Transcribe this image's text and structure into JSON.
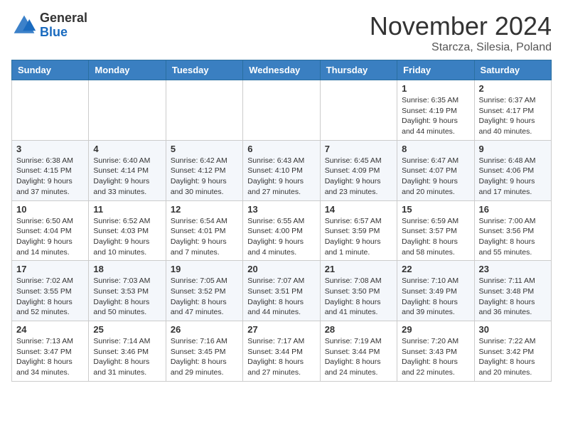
{
  "header": {
    "logo_general": "General",
    "logo_blue": "Blue",
    "month_title": "November 2024",
    "location": "Starcza, Silesia, Poland"
  },
  "days_of_week": [
    "Sunday",
    "Monday",
    "Tuesday",
    "Wednesday",
    "Thursday",
    "Friday",
    "Saturday"
  ],
  "weeks": [
    [
      {
        "day": "",
        "detail": ""
      },
      {
        "day": "",
        "detail": ""
      },
      {
        "day": "",
        "detail": ""
      },
      {
        "day": "",
        "detail": ""
      },
      {
        "day": "",
        "detail": ""
      },
      {
        "day": "1",
        "detail": "Sunrise: 6:35 AM\nSunset: 4:19 PM\nDaylight: 9 hours and 44 minutes."
      },
      {
        "day": "2",
        "detail": "Sunrise: 6:37 AM\nSunset: 4:17 PM\nDaylight: 9 hours and 40 minutes."
      }
    ],
    [
      {
        "day": "3",
        "detail": "Sunrise: 6:38 AM\nSunset: 4:15 PM\nDaylight: 9 hours and 37 minutes."
      },
      {
        "day": "4",
        "detail": "Sunrise: 6:40 AM\nSunset: 4:14 PM\nDaylight: 9 hours and 33 minutes."
      },
      {
        "day": "5",
        "detail": "Sunrise: 6:42 AM\nSunset: 4:12 PM\nDaylight: 9 hours and 30 minutes."
      },
      {
        "day": "6",
        "detail": "Sunrise: 6:43 AM\nSunset: 4:10 PM\nDaylight: 9 hours and 27 minutes."
      },
      {
        "day": "7",
        "detail": "Sunrise: 6:45 AM\nSunset: 4:09 PM\nDaylight: 9 hours and 23 minutes."
      },
      {
        "day": "8",
        "detail": "Sunrise: 6:47 AM\nSunset: 4:07 PM\nDaylight: 9 hours and 20 minutes."
      },
      {
        "day": "9",
        "detail": "Sunrise: 6:48 AM\nSunset: 4:06 PM\nDaylight: 9 hours and 17 minutes."
      }
    ],
    [
      {
        "day": "10",
        "detail": "Sunrise: 6:50 AM\nSunset: 4:04 PM\nDaylight: 9 hours and 14 minutes."
      },
      {
        "day": "11",
        "detail": "Sunrise: 6:52 AM\nSunset: 4:03 PM\nDaylight: 9 hours and 10 minutes."
      },
      {
        "day": "12",
        "detail": "Sunrise: 6:54 AM\nSunset: 4:01 PM\nDaylight: 9 hours and 7 minutes."
      },
      {
        "day": "13",
        "detail": "Sunrise: 6:55 AM\nSunset: 4:00 PM\nDaylight: 9 hours and 4 minutes."
      },
      {
        "day": "14",
        "detail": "Sunrise: 6:57 AM\nSunset: 3:59 PM\nDaylight: 9 hours and 1 minute."
      },
      {
        "day": "15",
        "detail": "Sunrise: 6:59 AM\nSunset: 3:57 PM\nDaylight: 8 hours and 58 minutes."
      },
      {
        "day": "16",
        "detail": "Sunrise: 7:00 AM\nSunset: 3:56 PM\nDaylight: 8 hours and 55 minutes."
      }
    ],
    [
      {
        "day": "17",
        "detail": "Sunrise: 7:02 AM\nSunset: 3:55 PM\nDaylight: 8 hours and 52 minutes."
      },
      {
        "day": "18",
        "detail": "Sunrise: 7:03 AM\nSunset: 3:53 PM\nDaylight: 8 hours and 50 minutes."
      },
      {
        "day": "19",
        "detail": "Sunrise: 7:05 AM\nSunset: 3:52 PM\nDaylight: 8 hours and 47 minutes."
      },
      {
        "day": "20",
        "detail": "Sunrise: 7:07 AM\nSunset: 3:51 PM\nDaylight: 8 hours and 44 minutes."
      },
      {
        "day": "21",
        "detail": "Sunrise: 7:08 AM\nSunset: 3:50 PM\nDaylight: 8 hours and 41 minutes."
      },
      {
        "day": "22",
        "detail": "Sunrise: 7:10 AM\nSunset: 3:49 PM\nDaylight: 8 hours and 39 minutes."
      },
      {
        "day": "23",
        "detail": "Sunrise: 7:11 AM\nSunset: 3:48 PM\nDaylight: 8 hours and 36 minutes."
      }
    ],
    [
      {
        "day": "24",
        "detail": "Sunrise: 7:13 AM\nSunset: 3:47 PM\nDaylight: 8 hours and 34 minutes."
      },
      {
        "day": "25",
        "detail": "Sunrise: 7:14 AM\nSunset: 3:46 PM\nDaylight: 8 hours and 31 minutes."
      },
      {
        "day": "26",
        "detail": "Sunrise: 7:16 AM\nSunset: 3:45 PM\nDaylight: 8 hours and 29 minutes."
      },
      {
        "day": "27",
        "detail": "Sunrise: 7:17 AM\nSunset: 3:44 PM\nDaylight: 8 hours and 27 minutes."
      },
      {
        "day": "28",
        "detail": "Sunrise: 7:19 AM\nSunset: 3:44 PM\nDaylight: 8 hours and 24 minutes."
      },
      {
        "day": "29",
        "detail": "Sunrise: 7:20 AM\nSunset: 3:43 PM\nDaylight: 8 hours and 22 minutes."
      },
      {
        "day": "30",
        "detail": "Sunrise: 7:22 AM\nSunset: 3:42 PM\nDaylight: 8 hours and 20 minutes."
      }
    ]
  ]
}
